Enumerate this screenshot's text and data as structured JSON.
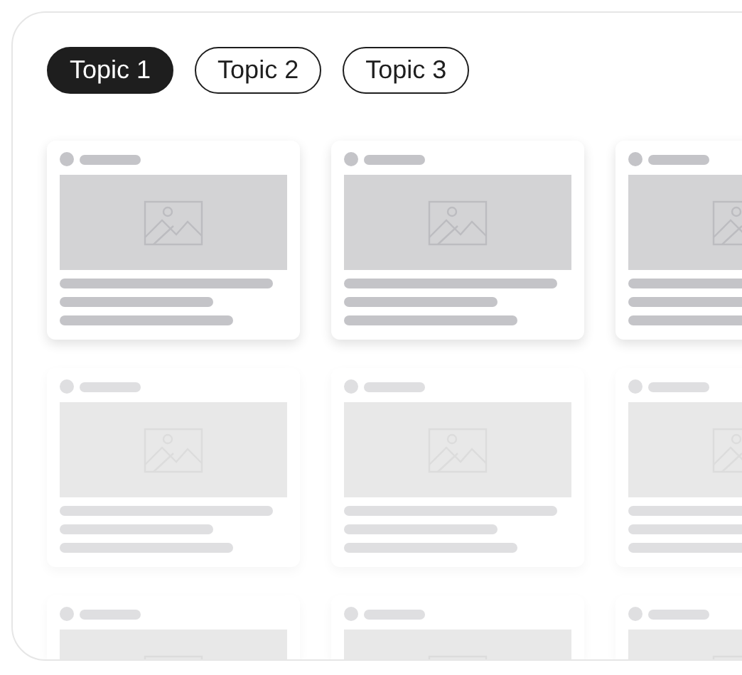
{
  "tabs": [
    {
      "label": "Topic 1",
      "selected": true
    },
    {
      "label": "Topic 2",
      "selected": false
    },
    {
      "label": "Topic 3",
      "selected": false
    }
  ],
  "cards": [
    {
      "faded": false
    },
    {
      "faded": false
    },
    {
      "faded": false
    },
    {
      "faded": true
    },
    {
      "faded": true
    },
    {
      "faded": true
    },
    {
      "faded": true,
      "kind": "cut"
    },
    {
      "faded": true,
      "kind": "cut"
    },
    {
      "faded": true,
      "kind": "cut"
    }
  ]
}
